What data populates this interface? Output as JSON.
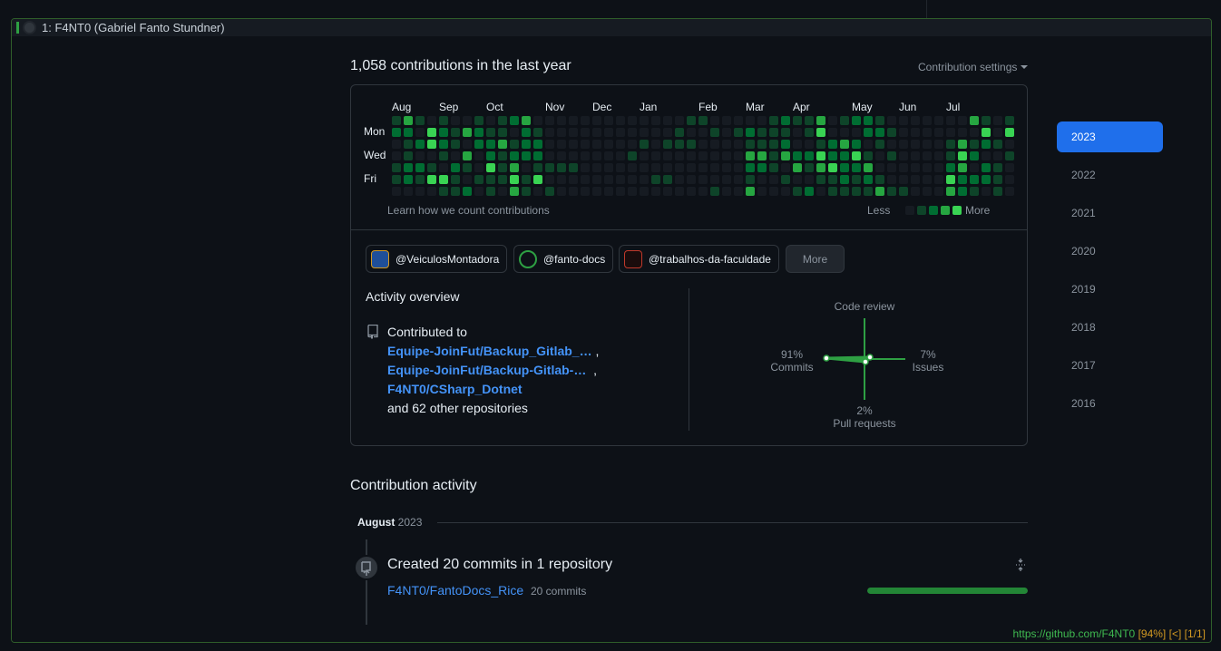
{
  "tab": {
    "title": "1: F4NT0 (Gabriel Fanto Stundner)"
  },
  "contributions": {
    "heading": "1,058 contributions in the last year",
    "settings_label": "Contribution settings",
    "months": [
      "Aug",
      "Sep",
      "Oct",
      "Nov",
      "Dec",
      "Jan",
      "Feb",
      "Mar",
      "Apr",
      "May",
      "Jun",
      "Jul"
    ],
    "days": [
      "Mon",
      "Wed",
      "Fri"
    ],
    "learn_link": "Learn how we count contributions",
    "legend_less": "Less",
    "legend_more": "More",
    "colors": [
      "#161b22",
      "#0e4429",
      "#006d32",
      "#26a641",
      "#39d353"
    ]
  },
  "orgs": {
    "items": [
      {
        "label": "@VeiculosMontadora",
        "avatar_icon": "veiculos-avatar-icon",
        "color": "#1f4f99"
      },
      {
        "label": "@fanto-docs",
        "avatar_icon": "fanto-docs-avatar-icon",
        "color": "#2ea043"
      },
      {
        "label": "@trabalhos-da-faculdade",
        "avatar_icon": "faculdade-avatar-icon",
        "color": "#c0392b"
      }
    ],
    "more_label": "More"
  },
  "activity": {
    "title": "Activity overview",
    "contributed_to": "Contributed to",
    "repos": [
      "Equipe-JoinFut/Backup_Gitlab_…",
      "Equipe-JoinFut/Backup-Gitlab-…",
      "F4NT0/CSharp_Dotnet"
    ],
    "other": "and 62 other repositories",
    "code_review": {
      "title": "Code review",
      "commits_pct": "91%",
      "commits_label": "Commits",
      "issues_pct": "7%",
      "issues_label": "Issues",
      "pr_pct": "2%",
      "pr_label": "Pull requests"
    }
  },
  "years": [
    "2023",
    "2022",
    "2021",
    "2020",
    "2019",
    "2018",
    "2017",
    "2016"
  ],
  "contribution_activity": {
    "title": "Contribution activity",
    "month": "August",
    "year": "2023",
    "created": "Created 20 commits in 1 repository",
    "repo": "F4NT0/FantoDocs_Rice",
    "commit_count": "20 commits",
    "bar_fraction": 1.0
  },
  "statusbar": {
    "url": "https://github.com/F4NT0",
    "zoom": "[94%]",
    "nav": "[<]",
    "tabs": "[1/1]"
  }
}
